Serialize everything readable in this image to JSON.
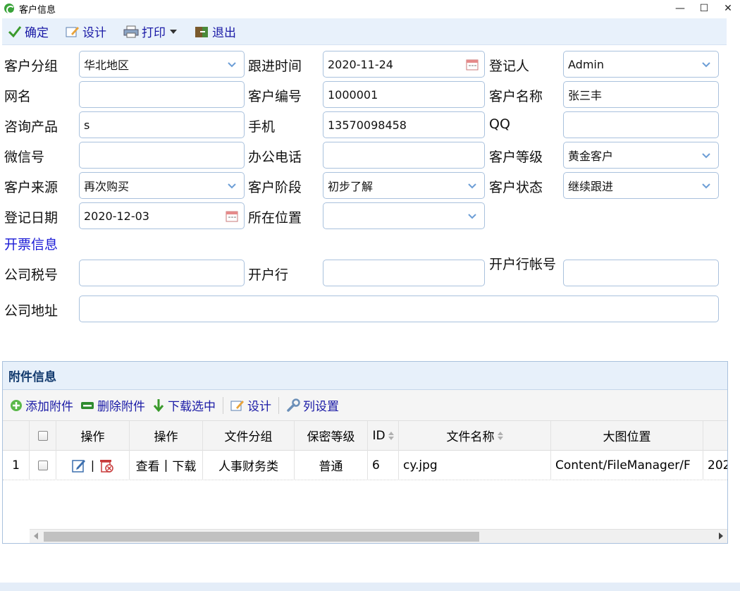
{
  "window": {
    "title": "客户信息",
    "min": "—",
    "max": "☐",
    "close": "✕"
  },
  "toolbar": {
    "confirm": "确定",
    "design": "设计",
    "print": "打印",
    "exit": "退出"
  },
  "form": {
    "group": {
      "label": "客户分组",
      "value": "华北地区"
    },
    "follow_time": {
      "label": "跟进时间",
      "value": "2020-11-24"
    },
    "registrar": {
      "label": "登记人",
      "value": "Admin"
    },
    "netname": {
      "label": "网名",
      "value": ""
    },
    "customer_no": {
      "label": "客户编号",
      "value": "1000001"
    },
    "customer_name": {
      "label": "客户名称",
      "value": "张三丰"
    },
    "product": {
      "label": "咨询产品",
      "value": "s"
    },
    "mobile": {
      "label": "手机",
      "value": "13570098458"
    },
    "qq": {
      "label": "QQ",
      "value": ""
    },
    "wechat": {
      "label": "微信号",
      "value": ""
    },
    "office_phone": {
      "label": "办公电话",
      "value": ""
    },
    "level": {
      "label": "客户等级",
      "value": "黄金客户"
    },
    "source": {
      "label": "客户来源",
      "value": "再次购买"
    },
    "stage": {
      "label": "客户阶段",
      "value": "初步了解"
    },
    "status": {
      "label": "客户状态",
      "value": "继续跟进"
    },
    "reg_date": {
      "label": "登记日期",
      "value": "2020-12-03"
    },
    "location": {
      "label": "所在位置",
      "value": ""
    },
    "invoice_section": "开票信息",
    "tax_no": {
      "label": "公司税号",
      "value": ""
    },
    "bank": {
      "label": "开户行",
      "value": ""
    },
    "bank_account": {
      "label": "开户行帐号",
      "value": ""
    },
    "address": {
      "label": "公司地址",
      "value": ""
    }
  },
  "attachments": {
    "title": "附件信息",
    "toolbar": {
      "add": "添加附件",
      "delete": "删除附件",
      "download": "下载选中",
      "design": "设计",
      "columns": "列设置"
    },
    "headers": [
      "操作",
      "操作",
      "文件分组",
      "保密等级",
      "ID",
      "文件名称",
      "大图位置"
    ],
    "rows": [
      {
        "num": "1",
        "actions_sep": "|",
        "view": "查看",
        "sep": "|",
        "download": "下载",
        "group": "人事财务类",
        "secrecy": "普通",
        "id": "6",
        "filename": "cy.jpg",
        "path": "Content/FileManager/F",
        "date": "202"
      }
    ]
  }
}
